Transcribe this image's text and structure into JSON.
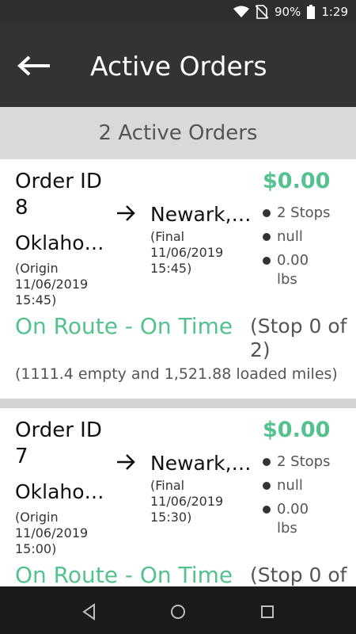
{
  "status_bar": {
    "battery_pct": "90%",
    "time": "1:29"
  },
  "app_bar": {
    "title": "Active Orders",
    "back_icon": "back-arrow-icon"
  },
  "subheader": {
    "count_text": "2 Active Orders"
  },
  "orders": [
    {
      "order_id": "Order ID 8",
      "origin_name": "Oklaho…",
      "origin_note": "(Origin 11/06/2019 15:45)",
      "dest_name": "Newark,…",
      "final_note": "(Final 11/06/2019 15:45)",
      "price": "$0.00",
      "stops": "2 Stops",
      "null_text": "null",
      "weight": "0.00 lbs",
      "status": "On Route - On Time",
      "stop_progress": "(Stop 0 of 2)",
      "miles": "(1111.4 empty and 1,521.88 loaded miles)"
    },
    {
      "order_id": "Order ID 7",
      "origin_name": "Oklaho…",
      "origin_note": "(Origin 11/06/2019 15:00)",
      "dest_name": "Newark,…",
      "final_note": "(Final 11/06/2019 15:30)",
      "price": "$0.00",
      "stops": "2 Stops",
      "null_text": "null",
      "weight": "0.00 lbs",
      "status": "On Route - On Time",
      "stop_progress": "(Stop 0 of",
      "miles": ""
    }
  ],
  "colors": {
    "accent_green": "#53c28f",
    "appbar_bg": "#333333",
    "subheader_bg": "#d9d9d9"
  },
  "nav_bar": {
    "back": "nav-back-icon",
    "home": "nav-home-icon",
    "recents": "nav-recents-icon"
  }
}
